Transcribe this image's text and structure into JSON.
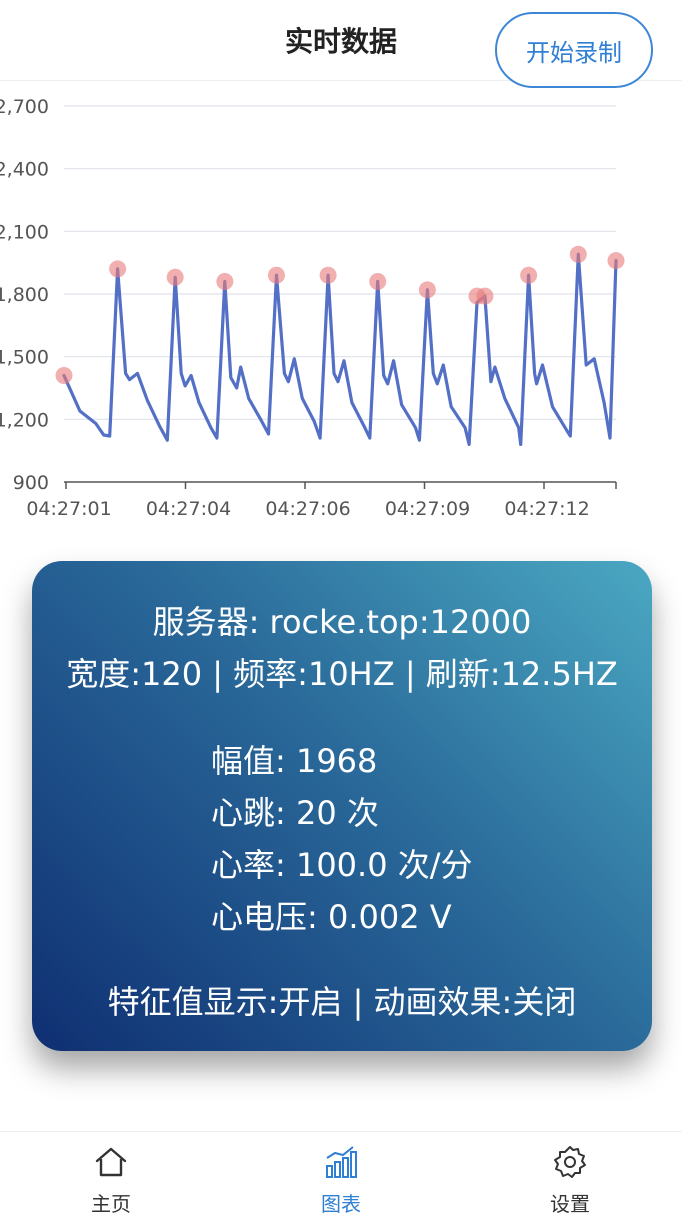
{
  "header": {
    "title": "实时数据",
    "record_button": "开始录制"
  },
  "chart_data": {
    "type": "line",
    "x_tick_labels": [
      "04:27:01",
      "04:27:04",
      "04:27:06",
      "04:27:09",
      "04:27:12"
    ],
    "y_ticks": [
      900,
      1200,
      1500,
      1800,
      2100,
      2400,
      2700
    ],
    "y_tick_labels": [
      "900",
      "1,200",
      "1,500",
      "1,800",
      "2,100",
      "2,400",
      "2,700"
    ],
    "ylim": [
      900,
      2700
    ],
    "xlim": [
      0,
      13.9
    ],
    "grid": true,
    "line_color": "#5470c6",
    "marker_color": "#e87a7a",
    "series": [
      {
        "values": [
          [
            0.0,
            1410
          ],
          [
            0.4,
            1240
          ],
          [
            0.8,
            1180
          ],
          [
            1.0,
            1125
          ],
          [
            1.15,
            1120
          ],
          [
            1.35,
            1920
          ],
          [
            1.55,
            1420
          ],
          [
            1.65,
            1390
          ],
          [
            1.85,
            1420
          ],
          [
            2.1,
            1290
          ],
          [
            2.4,
            1170
          ],
          [
            2.6,
            1100
          ],
          [
            2.8,
            1880
          ],
          [
            2.95,
            1420
          ],
          [
            3.05,
            1360
          ],
          [
            3.2,
            1410
          ],
          [
            3.4,
            1280
          ],
          [
            3.7,
            1160
          ],
          [
            3.85,
            1110
          ],
          [
            4.05,
            1860
          ],
          [
            4.2,
            1400
          ],
          [
            4.35,
            1350
          ],
          [
            4.45,
            1450
          ],
          [
            4.65,
            1300
          ],
          [
            4.95,
            1200
          ],
          [
            5.15,
            1130
          ],
          [
            5.35,
            1890
          ],
          [
            5.55,
            1420
          ],
          [
            5.65,
            1380
          ],
          [
            5.8,
            1490
          ],
          [
            6.0,
            1300
          ],
          [
            6.3,
            1190
          ],
          [
            6.45,
            1110
          ],
          [
            6.65,
            1890
          ],
          [
            6.8,
            1420
          ],
          [
            6.9,
            1380
          ],
          [
            7.05,
            1480
          ],
          [
            7.25,
            1280
          ],
          [
            7.55,
            1170
          ],
          [
            7.7,
            1110
          ],
          [
            7.9,
            1860
          ],
          [
            8.05,
            1410
          ],
          [
            8.15,
            1370
          ],
          [
            8.3,
            1480
          ],
          [
            8.5,
            1270
          ],
          [
            8.85,
            1160
          ],
          [
            8.95,
            1100
          ],
          [
            9.15,
            1820
          ],
          [
            9.3,
            1420
          ],
          [
            9.4,
            1370
          ],
          [
            9.55,
            1460
          ],
          [
            9.75,
            1260
          ],
          [
            10.1,
            1160
          ],
          [
            10.2,
            1080
          ],
          [
            10.4,
            1760
          ],
          [
            10.6,
            1790
          ],
          [
            10.75,
            1380
          ],
          [
            10.85,
            1450
          ],
          [
            11.1,
            1300
          ],
          [
            11.45,
            1160
          ],
          [
            11.5,
            1080
          ],
          [
            11.7,
            1890
          ],
          [
            11.85,
            1420
          ],
          [
            11.9,
            1370
          ],
          [
            12.05,
            1460
          ],
          [
            12.3,
            1260
          ],
          [
            12.65,
            1150
          ],
          [
            12.75,
            1120
          ],
          [
            12.95,
            1990
          ],
          [
            13.15,
            1460
          ],
          [
            13.35,
            1490
          ],
          [
            13.6,
            1280
          ],
          [
            13.75,
            1110
          ],
          [
            13.9,
            1960
          ]
        ]
      }
    ],
    "peaks": [
      [
        0.0,
        1410
      ],
      [
        1.35,
        1920
      ],
      [
        2.8,
        1880
      ],
      [
        4.05,
        1860
      ],
      [
        5.35,
        1890
      ],
      [
        6.65,
        1890
      ],
      [
        7.9,
        1860
      ],
      [
        9.15,
        1820
      ],
      [
        10.4,
        1790
      ],
      [
        10.6,
        1790
      ],
      [
        11.7,
        1890
      ],
      [
        12.95,
        1990
      ],
      [
        13.9,
        1960
      ]
    ]
  },
  "info_card": {
    "server": "服务器: rocke.top:12000",
    "settings": "宽度:120 | 频率:10HZ | 刷新:12.5HZ",
    "amplitude": "幅值: 1968",
    "beats": "心跳: 20 次",
    "heart_rate": "心率: 100.0 次/分",
    "voltage": "心电压: 0.002 V",
    "features": "特征值显示:开启 | 动画效果:关闭"
  },
  "bottom_nav": {
    "items": [
      {
        "label": "主页",
        "icon": "home-icon"
      },
      {
        "label": "图表",
        "icon": "chart-icon"
      },
      {
        "label": "设置",
        "icon": "settings-icon"
      }
    ],
    "active_color": "#2f7fd4"
  }
}
